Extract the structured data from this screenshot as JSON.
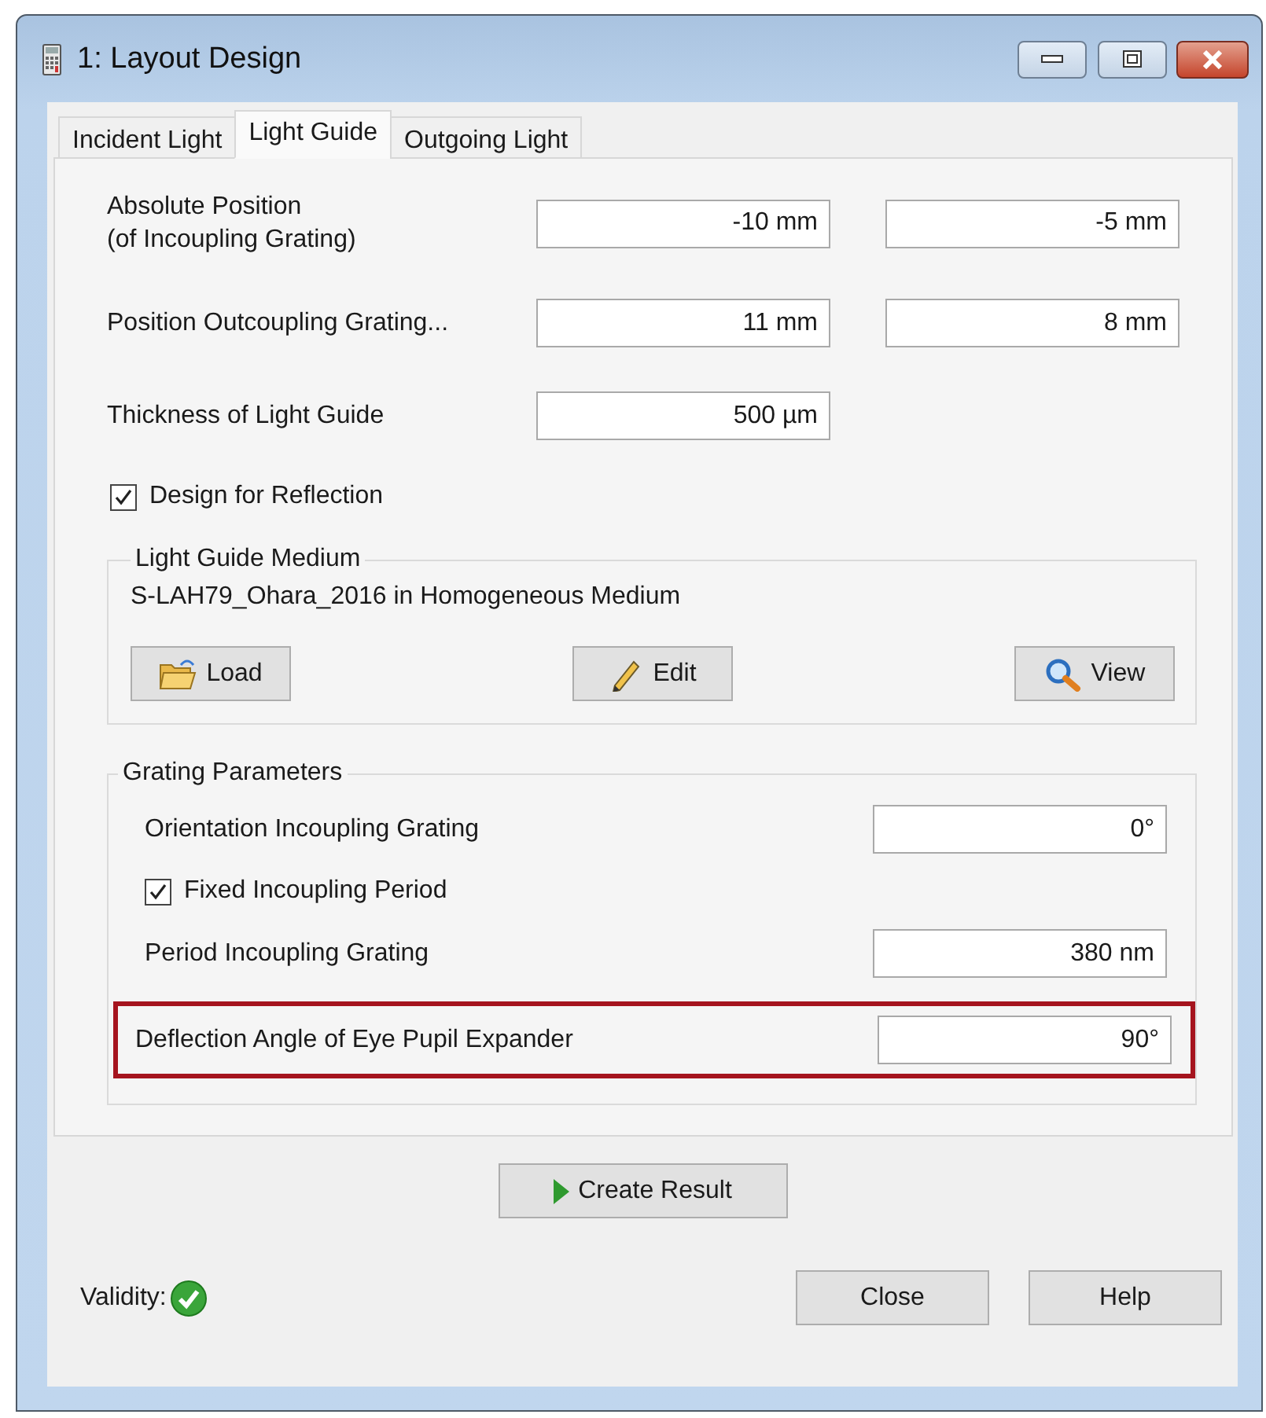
{
  "window": {
    "title": "1: Layout Design"
  },
  "tabs": [
    {
      "label": "Incident Light",
      "selected": false
    },
    {
      "label": "Light Guide",
      "selected": true
    },
    {
      "label": "Outgoing Light",
      "selected": false
    }
  ],
  "parameters": [
    {
      "kind": "pair",
      "label": "Absolute Position\n(of Incoupling Grating)",
      "values": [
        "-10 mm",
        "-5 mm"
      ]
    },
    {
      "kind": "pair",
      "label": "Position Outcoupling Grating...",
      "values": [
        "11 mm",
        "8 mm"
      ]
    },
    {
      "kind": "single",
      "label": "Thickness of Light Guide",
      "values": [
        "500 µm"
      ]
    },
    {
      "kind": "checkbox",
      "label": "Design for Reflection",
      "checked": true
    }
  ],
  "medium": {
    "title": "Light Guide Medium",
    "description": "S-LAH79_Ohara_2016 in Homogeneous Medium",
    "buttons": [
      {
        "kind": "load",
        "label": "Load"
      },
      {
        "kind": "edit",
        "label": "Edit"
      },
      {
        "kind": "view",
        "label": "View"
      }
    ]
  },
  "grating": {
    "title": "Grating Parameters",
    "rows": [
      {
        "kind": "field",
        "label": "Orientation Incoupling Grating",
        "value": "0°",
        "highlighted": false
      },
      {
        "kind": "checkbox",
        "label": "Fixed Incoupling Period",
        "checked": true
      },
      {
        "kind": "field",
        "label": "Period Incoupling Grating",
        "value": "380 nm",
        "highlighted": false
      },
      {
        "kind": "field",
        "label": "Deflection Angle of Eye Pupil Expander",
        "value": "90°",
        "highlighted": true
      }
    ]
  },
  "create_button": "Create Result",
  "validity": {
    "label": "Validity:",
    "valid": true
  },
  "buttons": [
    "Close",
    "Help"
  ]
}
